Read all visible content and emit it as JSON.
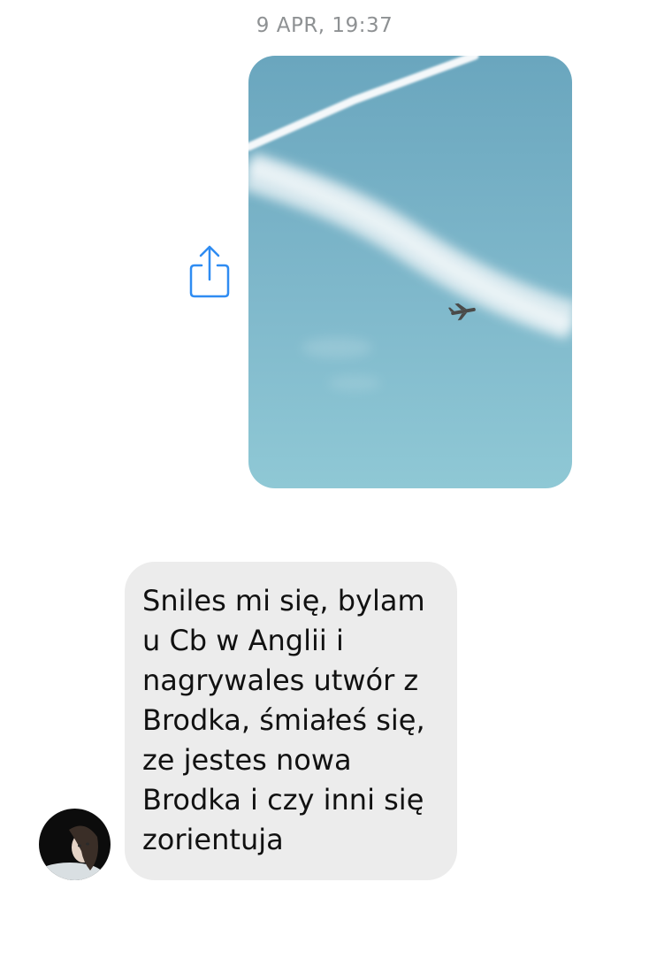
{
  "conversation": {
    "timestamp": "9 APR, 19:37",
    "messages": [
      {
        "sender": "me",
        "kind": "photo",
        "photo_description_icon": "sky-contrail-airplane-photo",
        "share_icon": "share-icon"
      },
      {
        "sender": "contact",
        "kind": "text",
        "text": "Sniles mi się, bylam\nu Cb w Anglii i\nnagrywales utwór z\nBrodka, śmiałeś się,\nze jestes nowa\nBrodka i czy inni się\nzorientuja",
        "avatar_icon": "contact-avatar"
      }
    ]
  },
  "colors": {
    "background": "#ffffff",
    "timestamp": "#8e9193",
    "incoming_bubble": "#ececec",
    "share_icon": "#2f8cf2",
    "sky_top": "#6aa6be",
    "sky_bottom": "#8cc6d4"
  }
}
